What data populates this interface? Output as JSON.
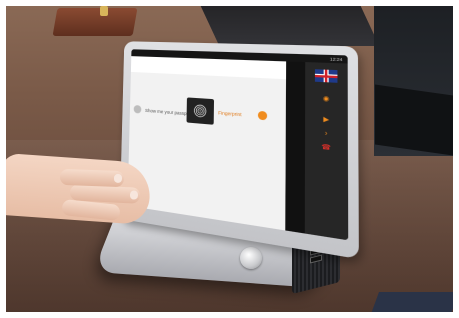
{
  "scene": {
    "description_labels": {
      "device": "fingerprint-terminal"
    }
  },
  "screen": {
    "header_text": "",
    "mid_label": "",
    "prompt_text": "Show me your passport please",
    "fingerprint_text": "Fingerprint",
    "status": {
      "battery": "",
      "time": "12:24"
    }
  },
  "sidebar": {
    "flag_label": "",
    "items": [
      {
        "label": "",
        "icon": "speaker-icon"
      },
      {
        "label": "",
        "icon": "play-icon"
      },
      {
        "label": "",
        "icon": "chevron-icon"
      },
      {
        "label": "",
        "icon": "phone-icon"
      }
    ]
  },
  "device": {
    "brand": ""
  }
}
